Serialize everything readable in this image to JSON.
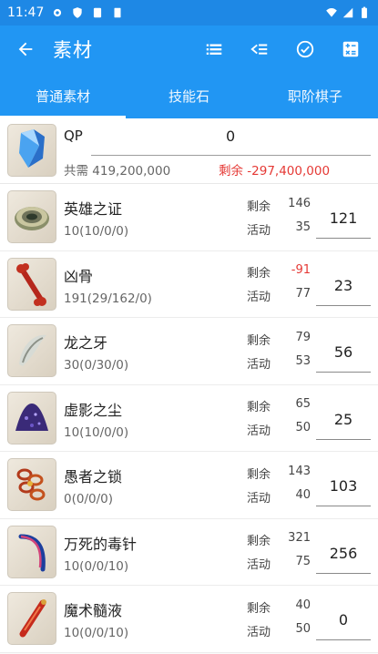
{
  "status_bar": {
    "time": "11:47"
  },
  "app_bar": {
    "title": "素材"
  },
  "tabs": [
    {
      "label": "普通素材"
    },
    {
      "label": "技能石"
    },
    {
      "label": "职阶棋子"
    }
  ],
  "qp": {
    "name": "QP",
    "value": "0",
    "total": "共需 419,200,000",
    "remain": "剩余 -297,400,000"
  },
  "labels": {
    "remain": "剩余",
    "event": "活动"
  },
  "items": [
    {
      "name": "英雄之证",
      "detail": "10(10/0/0)",
      "remain": "146",
      "event": "35",
      "qty": "121",
      "icon": "emblem-icon"
    },
    {
      "name": "凶骨",
      "detail": "191(29/162/0)",
      "remain": "-91",
      "event": "77",
      "qty": "23",
      "icon": "bone-icon"
    },
    {
      "name": "龙之牙",
      "detail": "30(0/30/0)",
      "remain": "79",
      "event": "53",
      "qty": "56",
      "icon": "fang-icon"
    },
    {
      "name": "虚影之尘",
      "detail": "10(10/0/0)",
      "remain": "65",
      "event": "50",
      "qty": "25",
      "icon": "dust-icon"
    },
    {
      "name": "愚者之锁",
      "detail": "0(0/0/0)",
      "remain": "143",
      "event": "40",
      "qty": "103",
      "icon": "chain-icon"
    },
    {
      "name": "万死的毒针",
      "detail": "10(0/0/10)",
      "remain": "321",
      "event": "75",
      "qty": "256",
      "icon": "needle-icon"
    },
    {
      "name": "魔术髓液",
      "detail": "10(0/0/10)",
      "remain": "40",
      "event": "50",
      "qty": "0",
      "icon": "vial-icon"
    }
  ],
  "colors": {
    "primary": "#2196f3",
    "status": "#1e88e5",
    "negative": "#e53935"
  }
}
